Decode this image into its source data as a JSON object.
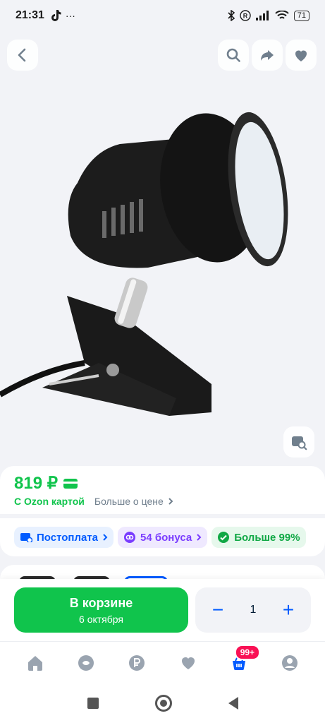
{
  "status_bar": {
    "time": "21:31",
    "dots": "···",
    "battery": "71"
  },
  "product": {
    "price": "819 ₽",
    "ozon_card_label": "С Ozon картой",
    "more_price_label": "Больше о цене"
  },
  "chips": [
    {
      "label": "Постоплата",
      "icon": "postpay-icon"
    },
    {
      "label": "54 бонуса",
      "icon": "bonus-icon"
    },
    {
      "label": "Больше 99%",
      "icon": "rating-icon"
    }
  ],
  "actions": {
    "cart_title": "В корзине",
    "cart_subtitle": "6 октября",
    "quantity": "1",
    "minus": "−",
    "plus": "+"
  },
  "nav": {
    "cart_badge": "99+",
    "items": [
      "home-icon",
      "fresh-icon",
      "finance-icon",
      "favorites-icon",
      "cart-icon",
      "profile-icon"
    ]
  },
  "colors": {
    "accent_green": "#10c44c",
    "brand_blue": "#005bff",
    "badge_pink": "#f91155"
  }
}
